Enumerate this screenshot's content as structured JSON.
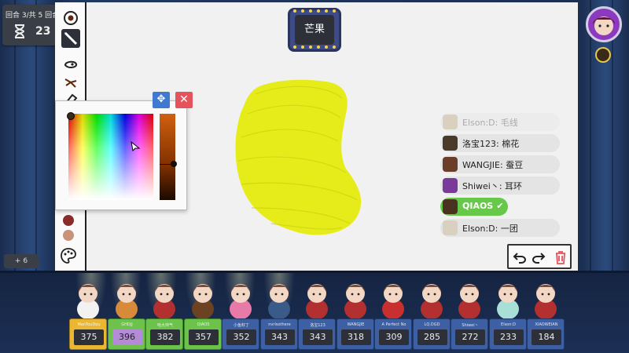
{
  "round": {
    "text": "回合 3/共 5 回合",
    "timer": "23"
  },
  "word": "芒果",
  "extra_points": "+ 6",
  "tools": [
    {
      "icon": "brush-size-icon",
      "selected": false
    },
    {
      "icon": "pencil-icon",
      "selected": true
    },
    {
      "icon": "fill-bucket-icon",
      "selected": false
    },
    {
      "icon": "spray-icon",
      "selected": false
    },
    {
      "icon": "eraser-icon",
      "selected": false
    }
  ],
  "swatches": [
    "#8a2b2b",
    "#c8917a"
  ],
  "color_picker": {
    "current_color": "#3a2a1a",
    "hue_color": "#d06010"
  },
  "drawing_color": "#e6ec1a",
  "chat": [
    {
      "name": "Elson:D",
      "message": "毛线",
      "status": "faded",
      "avatar_color": "#d9d0c0"
    },
    {
      "name": "洛宝123",
      "message": "棉花",
      "status": "normal",
      "avatar_color": "#4a3a2a"
    },
    {
      "name": "WANGJIE",
      "message": "蚕豆",
      "status": "normal",
      "avatar_color": "#6b3e2a"
    },
    {
      "name": "Shiwei丶",
      "message": "耳环",
      "status": "normal",
      "avatar_color": "#7a3a9a"
    },
    {
      "name": "QIAOS",
      "message": "",
      "status": "correct",
      "avatar_color": "#4a3220"
    },
    {
      "name": "Elson:D",
      "message": "一团",
      "status": "normal",
      "avatar_color": "#d9d0c0"
    }
  ],
  "players": [
    {
      "name": "ManTouDou",
      "score": "375",
      "card": "gold",
      "char_color": "#f2f2f2"
    },
    {
      "name": "GHDJJ",
      "score": "396",
      "card": "green",
      "char_color": "#d68a3a",
      "score_style": "purple"
    },
    {
      "name": "哈大帅气",
      "score": "382",
      "card": "green",
      "char_color": "#b33030"
    },
    {
      "name": "QIAOS",
      "score": "357",
      "card": "green",
      "char_color": "#6b4222"
    },
    {
      "name": "小鱼籽丁",
      "score": "352",
      "card": "blue",
      "char_color": "#e87aa8"
    },
    {
      "name": "nvrlsothere",
      "score": "343",
      "card": "blue",
      "char_color": "#3a5a8a"
    },
    {
      "name": "洛宝123",
      "score": "343",
      "card": "blue",
      "char_color": "#b33030"
    },
    {
      "name": "WANGJIE",
      "score": "318",
      "card": "blue",
      "char_color": "#b33030"
    },
    {
      "name": "A Perfect No",
      "score": "309",
      "card": "blue",
      "char_color": "#c83030"
    },
    {
      "name": "LQ.DGD",
      "score": "285",
      "card": "blue",
      "char_color": "#b33030"
    },
    {
      "name": "Shiwei丶",
      "score": "272",
      "card": "blue",
      "char_color": "#b33030"
    },
    {
      "name": "Elson:D",
      "score": "233",
      "card": "blue",
      "char_color": "#a8e0d8"
    },
    {
      "name": "XIAOWEIAN",
      "score": "184",
      "card": "blue",
      "char_color": "#b33030"
    }
  ],
  "colors": {
    "correct_green": "#67c84a",
    "close_red": "#e5545c",
    "move_blue": "#3f79d0",
    "card_gold": "#e9b731",
    "card_green": "#6cc24a",
    "card_blue": "#3d5fa3"
  }
}
